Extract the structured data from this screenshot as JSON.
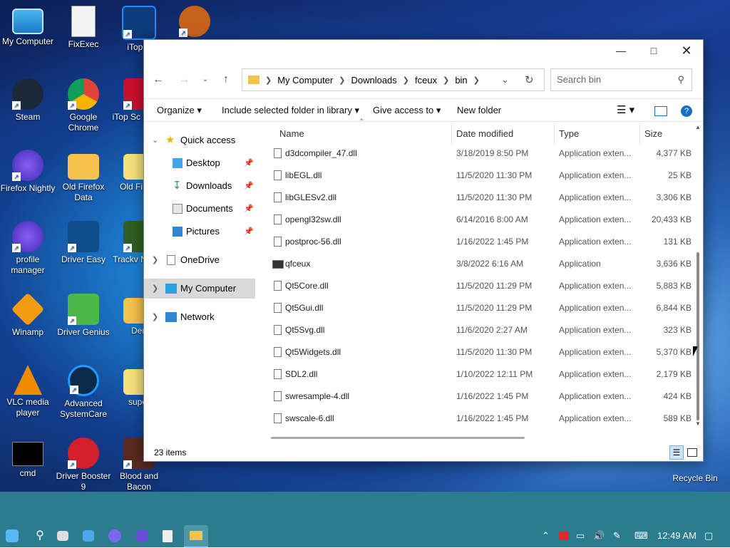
{
  "desktop": {
    "icons": [
      {
        "label": "My Computer"
      },
      {
        "label": "FixExec"
      },
      {
        "label": "iTop V"
      },
      {
        "label": "Steam"
      },
      {
        "label": "Google Chrome"
      },
      {
        "label": "iTop Sc Recor"
      },
      {
        "label": "Firefox Nightly"
      },
      {
        "label": "Old Firefox Data"
      },
      {
        "label": "Old Fi Dat"
      },
      {
        "label": "profile manager"
      },
      {
        "label": "Driver Easy"
      },
      {
        "label": "Trackv Nation"
      },
      {
        "label": "Winamp"
      },
      {
        "label": "Driver Genius"
      },
      {
        "label": "Den"
      },
      {
        "label": "VLC media player"
      },
      {
        "label": "Advanced SystemCare"
      },
      {
        "label": "super"
      },
      {
        "label": "cmd"
      },
      {
        "label": "Driver Booster 9"
      },
      {
        "label": "Blood and Bacon"
      },
      {
        "label": "Recycle Bin"
      }
    ]
  },
  "window": {
    "breadcrumb": [
      "My Computer",
      "Downloads",
      "fceux",
      "bin"
    ],
    "search_placeholder": "Search bin",
    "commands": {
      "organize": "Organize",
      "include": "Include selected folder in library",
      "give_access": "Give access to",
      "new_folder": "New folder"
    },
    "nav": {
      "quick_access": "Quick access",
      "desktop": "Desktop",
      "downloads": "Downloads",
      "documents": "Documents",
      "pictures": "Pictures",
      "onedrive": "OneDrive",
      "my_computer": "My Computer",
      "network": "Network"
    },
    "columns": {
      "name": "Name",
      "date": "Date modified",
      "type": "Type",
      "size": "Size"
    },
    "files": [
      {
        "name": "d3dcompiler_47.dll",
        "date": "3/18/2019 8:50 PM",
        "type": "Application exten...",
        "size": "4,377 KB"
      },
      {
        "name": "libEGL.dll",
        "date": "11/5/2020 11:30 PM",
        "type": "Application exten...",
        "size": "25 KB"
      },
      {
        "name": "libGLESv2.dll",
        "date": "11/5/2020 11:30 PM",
        "type": "Application exten...",
        "size": "3,306 KB"
      },
      {
        "name": "opengl32sw.dll",
        "date": "6/14/2016 8:00 AM",
        "type": "Application exten...",
        "size": "20,433 KB"
      },
      {
        "name": "postproc-56.dll",
        "date": "1/16/2022 1:45 PM",
        "type": "Application exten...",
        "size": "131 KB"
      },
      {
        "name": "qfceux",
        "date": "3/8/2022 6:16 AM",
        "type": "Application",
        "size": "3,636 KB"
      },
      {
        "name": "Qt5Core.dll",
        "date": "11/5/2020 11:29 PM",
        "type": "Application exten...",
        "size": "5,883 KB"
      },
      {
        "name": "Qt5Gui.dll",
        "date": "11/5/2020 11:29 PM",
        "type": "Application exten...",
        "size": "6,844 KB"
      },
      {
        "name": "Qt5Svg.dll",
        "date": "11/6/2020 2:27 AM",
        "type": "Application exten...",
        "size": "323 KB"
      },
      {
        "name": "Qt5Widgets.dll",
        "date": "11/5/2020 11:30 PM",
        "type": "Application exten...",
        "size": "5,370 KB"
      },
      {
        "name": "SDL2.dll",
        "date": "1/10/2022 12:11 PM",
        "type": "Application exten...",
        "size": "2,179 KB"
      },
      {
        "name": "swresample-4.dll",
        "date": "1/16/2022 1:45 PM",
        "type": "Application exten...",
        "size": "424 KB"
      },
      {
        "name": "swscale-6.dll",
        "date": "1/16/2022 1:45 PM",
        "type": "Application exten...",
        "size": "589 KB"
      }
    ],
    "status": "23 items"
  },
  "taskbar": {
    "time": "12:49 AM"
  }
}
